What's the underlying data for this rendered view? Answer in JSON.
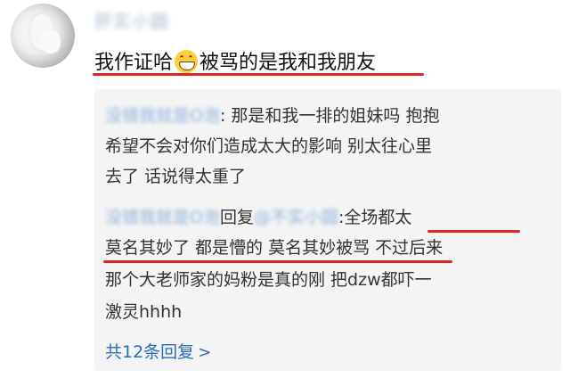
{
  "post": {
    "username_visible": "肝实小圆",
    "comment": {
      "part1": "我作证哈",
      "emoji": "grin-emoji",
      "part2": "被骂的是我和我朋友"
    }
  },
  "replies": [
    {
      "author": "没错我就是O泡",
      "text_line1": "那是和我一排的姐妹吗 抱抱",
      "text_line2": "希望不会对你们造成太大的影响 别太往心里",
      "text_line3": "去了 话说得太重了"
    },
    {
      "author": "没错我就是O泡",
      "reply_prefix": "回复",
      "mention": "@不实小圆",
      "colon": ":",
      "text_line1_tail": "全场都太",
      "text_line2_a": "莫名其妙了 都是懵的 莫名其妙被骂",
      "text_line2_b": " 不过后来",
      "text_line3": "那个大老师家的妈粉是真的刚 把dzw都吓一",
      "text_line4": "激灵hhhh"
    }
  ],
  "more_replies": "共12条回复",
  "colors": {
    "name_blue": "#2d6bc0",
    "underline_red": "#e0241f",
    "reply_bg": "#f4f4f4"
  }
}
